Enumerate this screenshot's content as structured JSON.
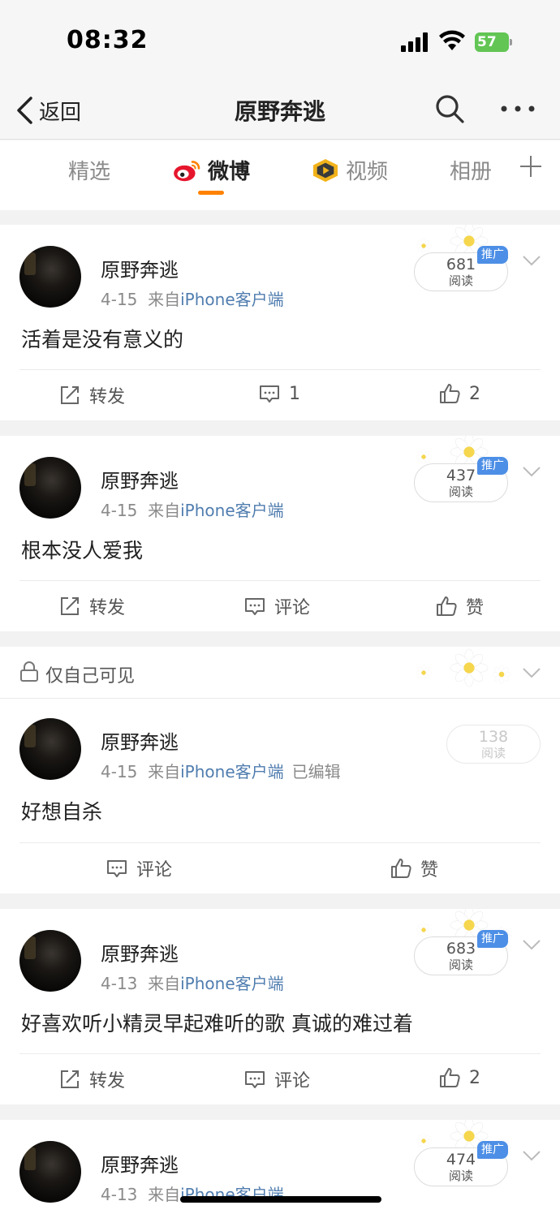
{
  "status_bar": {
    "time": "08:32",
    "battery": "57"
  },
  "nav": {
    "back_label": "返回",
    "title": "原野奔逃"
  },
  "tabs": [
    {
      "label": "精选",
      "active": false
    },
    {
      "label": "微博",
      "active": true
    },
    {
      "label": "视频",
      "active": false
    },
    {
      "label": "相册",
      "active": false
    }
  ],
  "posts": [
    {
      "author": "原野奔逃",
      "date": "4-15",
      "source_prefix": "来自",
      "source": "iPhone客户端",
      "reads": "681",
      "reads_label": "阅读",
      "promo": "推广",
      "text": "活着是没有意义的",
      "repost": "转发",
      "comments": "1",
      "likes": "2"
    },
    {
      "author": "原野奔逃",
      "date": "4-15",
      "source_prefix": "来自",
      "source": "iPhone客户端",
      "reads": "437",
      "reads_label": "阅读",
      "promo": "推广",
      "text": "根本没人爱我",
      "repost": "转发",
      "comments": "评论",
      "likes": "赞"
    },
    {
      "privacy": "仅自己可见",
      "author": "原野奔逃",
      "date": "4-15",
      "source_prefix": "来自",
      "source": "iPhone客户端",
      "edited": "已编辑",
      "reads": "138",
      "reads_label": "阅读",
      "text": "好想自杀",
      "comments": "评论",
      "likes": "赞"
    },
    {
      "author": "原野奔逃",
      "date": "4-13",
      "source_prefix": "来自",
      "source": "iPhone客户端",
      "reads": "683",
      "reads_label": "阅读",
      "promo": "推广",
      "text": "好喜欢听小精灵早起难听的歌 真诚的难过着",
      "repost": "转发",
      "comments": "评论",
      "likes": "2"
    },
    {
      "author": "原野奔逃",
      "date": "4-13",
      "source_prefix": "来自",
      "source": "iPhone客户端",
      "reads": "474",
      "reads_label": "阅读",
      "promo": "推广"
    }
  ],
  "colors": {
    "accent": "#ff8200",
    "link": "#507daf",
    "promo": "#4d8fe6",
    "battery": "#62c554"
  }
}
